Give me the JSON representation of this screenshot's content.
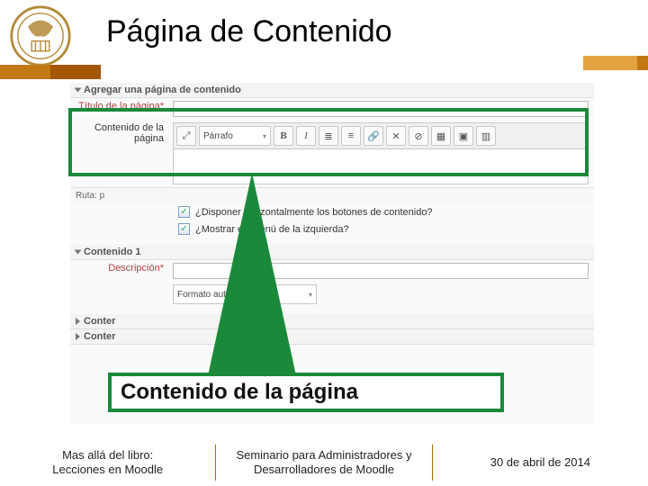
{
  "header": {
    "title": "Página de Contenido"
  },
  "editor": {
    "section_add": "Agregar una página de contenido",
    "title_label": "Título de la página",
    "content_label": "Contenido de la página",
    "para_select": "Párrafo",
    "ruta": "Ruta: p",
    "opt1": "¿Disponer horizontalmente los botones de contenido?",
    "opt2": "¿Mostrar en menú de la izquierda?",
    "section_c1": "Contenido 1",
    "desc_label": "Descripción",
    "format_select": "Formato automático",
    "conter_prefix": "Conter"
  },
  "callout": {
    "text": "Contenido de la página"
  },
  "footer": {
    "left_l1": "Mas allá del libro:",
    "left_l2": "Lecciones en Moodle",
    "mid_l1": "Seminario para Administradores y",
    "mid_l2": "Desarrolladores de Moodle",
    "right": "30 de abril de 2014"
  },
  "icons": {
    "bold": "B",
    "italic": "I",
    "ul": "≣",
    "ol": "≡",
    "link": "🔗",
    "unlink": "✕",
    "nolink": "⊘",
    "img": "▦",
    "media": "▣",
    "files": "▥",
    "expand": "⤢",
    "check": "✓",
    "chev": "▾"
  }
}
